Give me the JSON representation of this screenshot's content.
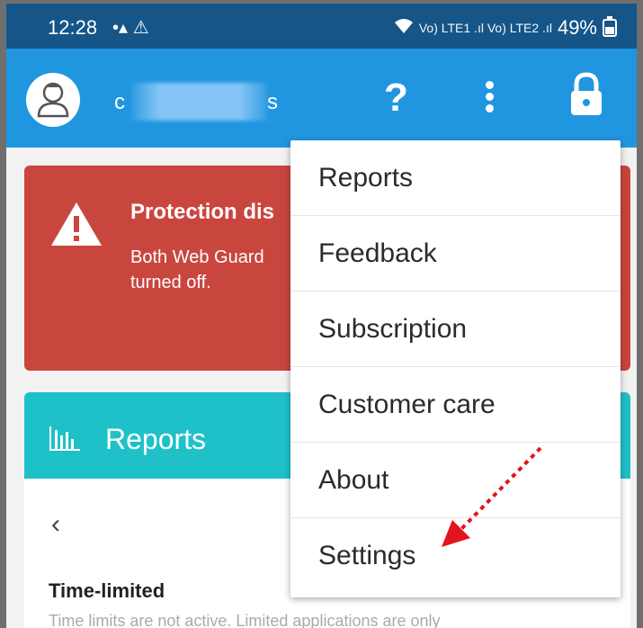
{
  "status_bar": {
    "time": "12:28",
    "left_icons": "•▴ ⚠",
    "signal": "Vo) LTE1 .ıl Vo) LTE2 .ıl",
    "battery": "49%"
  },
  "app_bar": {
    "user_name_start": "c",
    "user_name_end": "s",
    "help_label": "?"
  },
  "alert": {
    "title": "Protection dis",
    "body": "Both Web Guard turned off."
  },
  "reports_card": {
    "title": "Reports",
    "back": "‹",
    "time_limited_title": "Time-limited",
    "time_limited_desc": "Time limits are not active. Limited applications are only"
  },
  "menu": {
    "items": [
      {
        "label": "Reports"
      },
      {
        "label": "Feedback"
      },
      {
        "label": "Subscription"
      },
      {
        "label": "Customer care"
      },
      {
        "label": "About"
      },
      {
        "label": "Settings"
      }
    ]
  },
  "colors": {
    "status_bar": "#155588",
    "app_bar": "#2196e0",
    "alert": "#c9463f",
    "reports_header": "#1fc1c9",
    "annotation": "#e3141b"
  }
}
